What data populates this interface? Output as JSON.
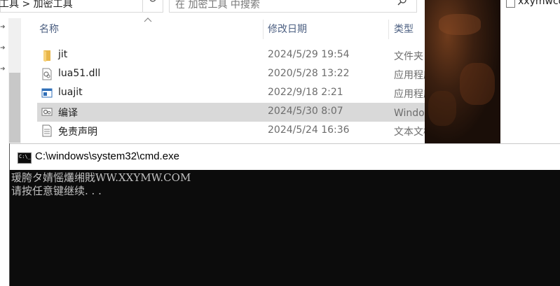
{
  "explorer": {
    "address": {
      "path": "工具  >  加密工具"
    },
    "search": {
      "placeholder": "在 加密工具 中搜索"
    },
    "columns": {
      "name": "名称",
      "modified": "修改日期",
      "type": "类型"
    },
    "files": [
      {
        "name": "jit",
        "modified": "2024/5/29 19:54",
        "type": "文件夹",
        "icon": "folder-icon",
        "selected": false
      },
      {
        "name": "lua51.dll",
        "modified": "2020/5/28 13:22",
        "type": "应用程序扩展",
        "icon": "dll-file-icon",
        "selected": false
      },
      {
        "name": "luajit",
        "modified": "2022/9/18 2:21",
        "type": "应用程序",
        "icon": "exe-app-icon",
        "selected": false
      },
      {
        "name": "编译",
        "modified": "2024/5/30 8:07",
        "type": "Windows 批处理文件",
        "icon": "batch-file-icon",
        "selected": true
      },
      {
        "name": "免责声明",
        "modified": "2024/5/24 16:36",
        "type": "文本文档",
        "icon": "text-document-icon",
        "selected": false
      }
    ]
  },
  "desktop": {
    "side_item_label": "xxymwcom"
  },
  "cmd": {
    "title": "C:\\windows\\system32\\cmd.exe",
    "icon_text": "C:\\_",
    "lines": [
      "瑗胯タ婧愮爜缃戝WW.XXYMW.COM",
      "请按任意键继续. . ."
    ]
  },
  "colors": {
    "cmd_bg": "#0c0c0c",
    "cmd_text": "#c0c0c0",
    "selected_row": "#d9d9d9",
    "header_text": "#4d6082"
  }
}
